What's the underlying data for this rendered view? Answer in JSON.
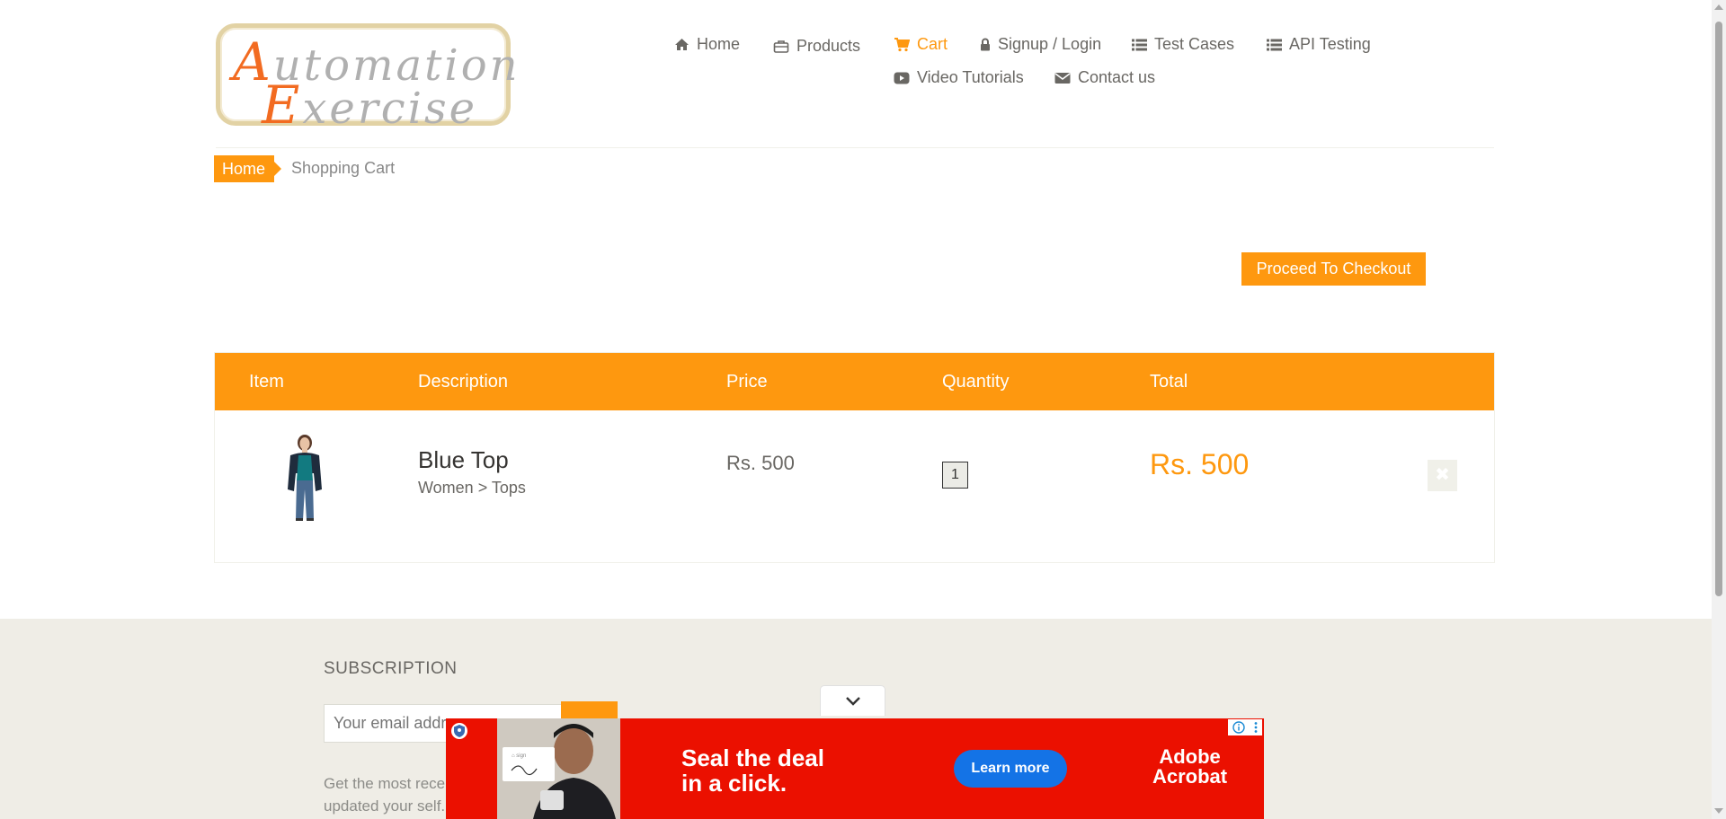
{
  "logo": {
    "line1_cap": "A",
    "line1_rest": "utomation",
    "line2_cap": "E",
    "line2_rest": "xercise"
  },
  "nav": {
    "items": [
      {
        "label": "Home",
        "icon": "home-icon"
      },
      {
        "label": "Products",
        "icon": "briefcase-icon"
      },
      {
        "label": "Cart",
        "icon": "shopping-cart-icon",
        "active": true
      },
      {
        "label": "Signup / Login",
        "icon": "lock-icon"
      },
      {
        "label": "Test Cases",
        "icon": "list-icon"
      },
      {
        "label": "API Testing",
        "icon": "list-icon"
      },
      {
        "label": "Video Tutorials",
        "icon": "youtube-play-icon"
      },
      {
        "label": "Contact us",
        "icon": "envelope-icon"
      }
    ]
  },
  "breadcrumb": {
    "home": "Home",
    "current": "Shopping Cart"
  },
  "checkout": {
    "button_label": "Proceed To Checkout"
  },
  "cart": {
    "headers": {
      "item": "Item",
      "description": "Description",
      "price": "Price",
      "quantity": "Quantity",
      "total": "Total"
    },
    "rows": [
      {
        "name": "Blue Top",
        "category": "Women > Tops",
        "price": "Rs. 500",
        "quantity": "1",
        "total": "Rs. 500",
        "delete_icon": "close-icon"
      }
    ]
  },
  "footer": {
    "subscription_title": "SUBSCRIPTION",
    "email_placeholder": "Your email address",
    "description": "Get the most recent updates from our site and be updated your self..."
  },
  "ad": {
    "headline_line1": "Seal the deal",
    "headline_line2": "in a click.",
    "cta": "Learn more",
    "brand_line1": "Adobe",
    "brand_line2": "Acrobat"
  },
  "colors": {
    "accent": "#fe980f",
    "text": "#696763",
    "footer_bg": "#efede6",
    "ad_red": "#eb1000",
    "ad_blue": "#1473e6"
  }
}
